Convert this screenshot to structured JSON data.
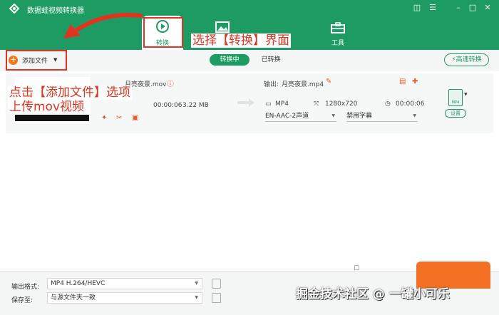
{
  "app": {
    "title": "数据蛙视频转换器"
  },
  "tabs": [
    {
      "label": "转换"
    },
    {
      "label": ""
    },
    {
      "label": "工具"
    }
  ],
  "toolbar": {
    "add_file": "添加文件",
    "converting": "转换中",
    "converted": "已转换",
    "fast": "高速转换"
  },
  "annotations": {
    "select_tab": "选择【转换】界面",
    "add_file_line1": "点击【添加文件】选项",
    "add_file_line2": "上传mov视频"
  },
  "file": {
    "source_name": "月亮夜景.mov",
    "duration": "00:00:06",
    "size": "3.22 MB",
    "output_label": "输出:",
    "output_name": "月亮夜景.mp4",
    "format": "MP4",
    "resolution": "1280x720",
    "out_duration": "00:00:06",
    "audio": "EN-AAC-2声道",
    "subtitle": "禁用字幕",
    "settings": "设置"
  },
  "bottom": {
    "format_label": "输出格式:",
    "format_value": "MP4 H.264/HEVC",
    "save_label": "保存至:",
    "save_value": "与源文件夹一致"
  },
  "watermark": "掘金技术社区 @ 一罐小可乐",
  "colors": {
    "brand": "#1e9b63",
    "accent": "#e03420",
    "convert": "#f47022"
  }
}
